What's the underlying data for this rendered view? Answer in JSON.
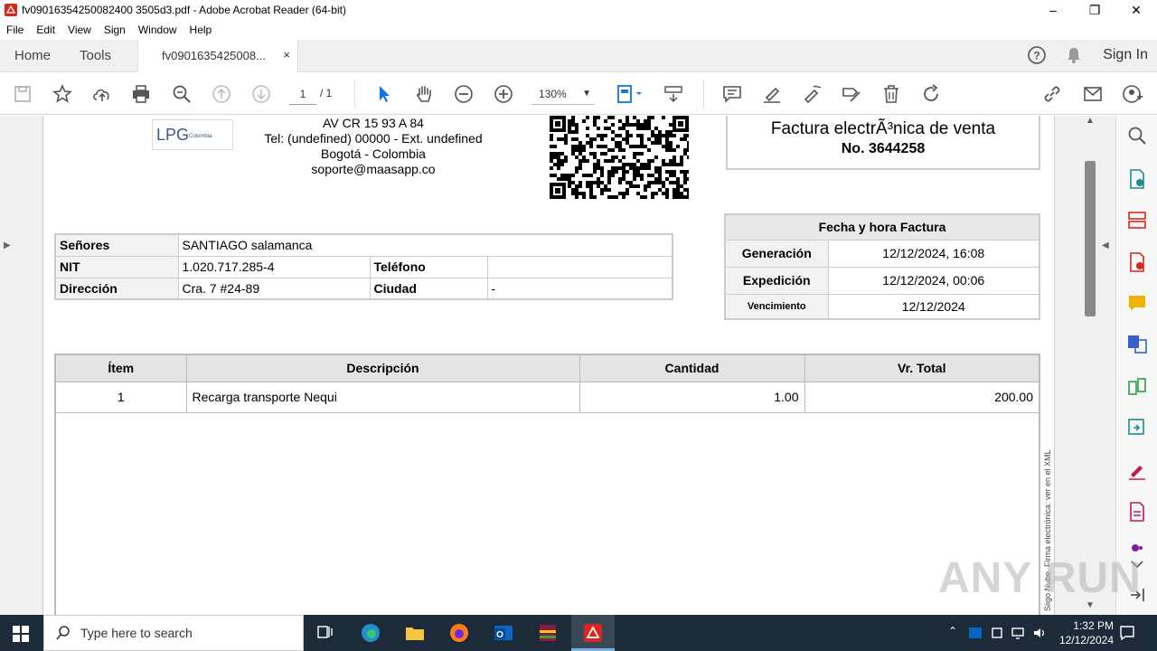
{
  "window": {
    "title": "fv09016354250082400 3505d3.pdf - Adobe Acrobat Reader (64-bit)",
    "minimize": "–",
    "maximize": "❐",
    "close": "✕"
  },
  "menu": [
    "File",
    "Edit",
    "View",
    "Sign",
    "Window",
    "Help"
  ],
  "tabs": {
    "home": "Home",
    "tools": "Tools",
    "document": "fv0901635425008...",
    "close": "×",
    "sign_in": "Sign In"
  },
  "toolbar": {
    "page_current": "1",
    "page_total": "/ 1",
    "zoom": "130%"
  },
  "document": {
    "issuer": {
      "logo_text": "LPG",
      "logo_sub": "Colombia",
      "address": "AV CR 15 93 A 84",
      "phone": "Tel: (undefined) 00000 - Ext. undefined",
      "city": "Bogotá - Colombia",
      "email": "soporte@maasapp.co"
    },
    "invoice": {
      "title": "Factura electrÃ³nica de venta",
      "number": "No. 3644258"
    },
    "customer": {
      "senores_label": "Señores",
      "senores_value": "SANTIAGO salamanca",
      "nit_label": "NIT",
      "nit_value": "1.020.717.285-4",
      "telefono_label": "Teléfono",
      "telefono_value": "",
      "direccion_label": "Dirección",
      "direccion_value": "Cra. 7 #24-89",
      "ciudad_label": "Ciudad",
      "ciudad_value": "-"
    },
    "dates": {
      "header": "Fecha y hora Factura",
      "generacion_label": "Generación",
      "generacion_value": "12/12/2024, 16:08",
      "expedicion_label": "Expedición",
      "expedicion_value": "12/12/2024, 00:06",
      "vencimiento_label": "Vencimiento",
      "vencimiento_value": "12/12/2024"
    },
    "items": {
      "headers": [
        "Ítem",
        "Descripción",
        "Cantidad",
        "Vr. Total"
      ],
      "rows": [
        [
          "1",
          "Recarga transporte Nequi",
          "1.00",
          "200.00"
        ]
      ]
    },
    "vertical_note": "Siigo Nube. Firma electrónica: ver en el XML"
  },
  "taskbar": {
    "search_placeholder": "Type here to search",
    "time": "1:32 PM",
    "date": "12/12/2024"
  },
  "watermark": "ANY RUN"
}
